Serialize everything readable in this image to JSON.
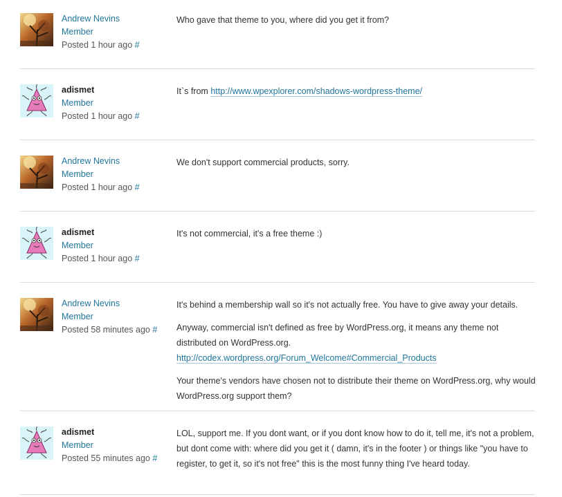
{
  "colors": {
    "link": "#21759b",
    "divider": "#dddddd",
    "text": "#333333"
  },
  "posts": [
    {
      "author": "Andrew Nevins",
      "role": "Member",
      "posted": "Posted 1 hour ago",
      "permalink": "#",
      "paragraphs": [
        "Who gave that theme to you, where did you get it from?"
      ]
    },
    {
      "author": "adismet",
      "role": "Member",
      "posted": "Posted 1 hour ago",
      "permalink": "#",
      "prefix": "It`s from ",
      "link": "http://www.wpexplorer.com/shadows-wordpress-theme/"
    },
    {
      "author": "Andrew Nevins",
      "role": "Member",
      "posted": "Posted 1 hour ago",
      "permalink": "#",
      "paragraphs": [
        "We don't support commercial products, sorry."
      ]
    },
    {
      "author": "adismet",
      "role": "Member",
      "posted": "Posted 1 hour ago",
      "permalink": "#",
      "paragraphs": [
        "It's not commercial, it's a free theme :)"
      ]
    },
    {
      "author": "Andrew Nevins",
      "role": "Member",
      "posted": "Posted 58 minutes ago",
      "permalink": "#",
      "paragraphs": [
        "It's behind a membership wall so it's not actually free. You have to give away your details.",
        "Anyway, commercial isn't defined as free by WordPress.org, it means any theme not distributed on WordPress.org.",
        "Your theme's vendors have chosen not to distribute their theme on WordPress.org, why would WordPress.org support them?"
      ],
      "link": "http://codex.wordpress.org/Forum_Welcome#Commercial_Products"
    },
    {
      "author": "adismet",
      "role": "Member",
      "posted": "Posted 55 minutes ago",
      "permalink": "#",
      "paragraphs": [
        "LOL, support me. If you dont want, or if you dont know how to do it, tell me, it's not a problem, but dont come with: where did you get it ( damn, it's in the footer ) or things like \"you have to register, to get it, so it's not free\" this is the most funny thing I've heard today."
      ]
    }
  ]
}
